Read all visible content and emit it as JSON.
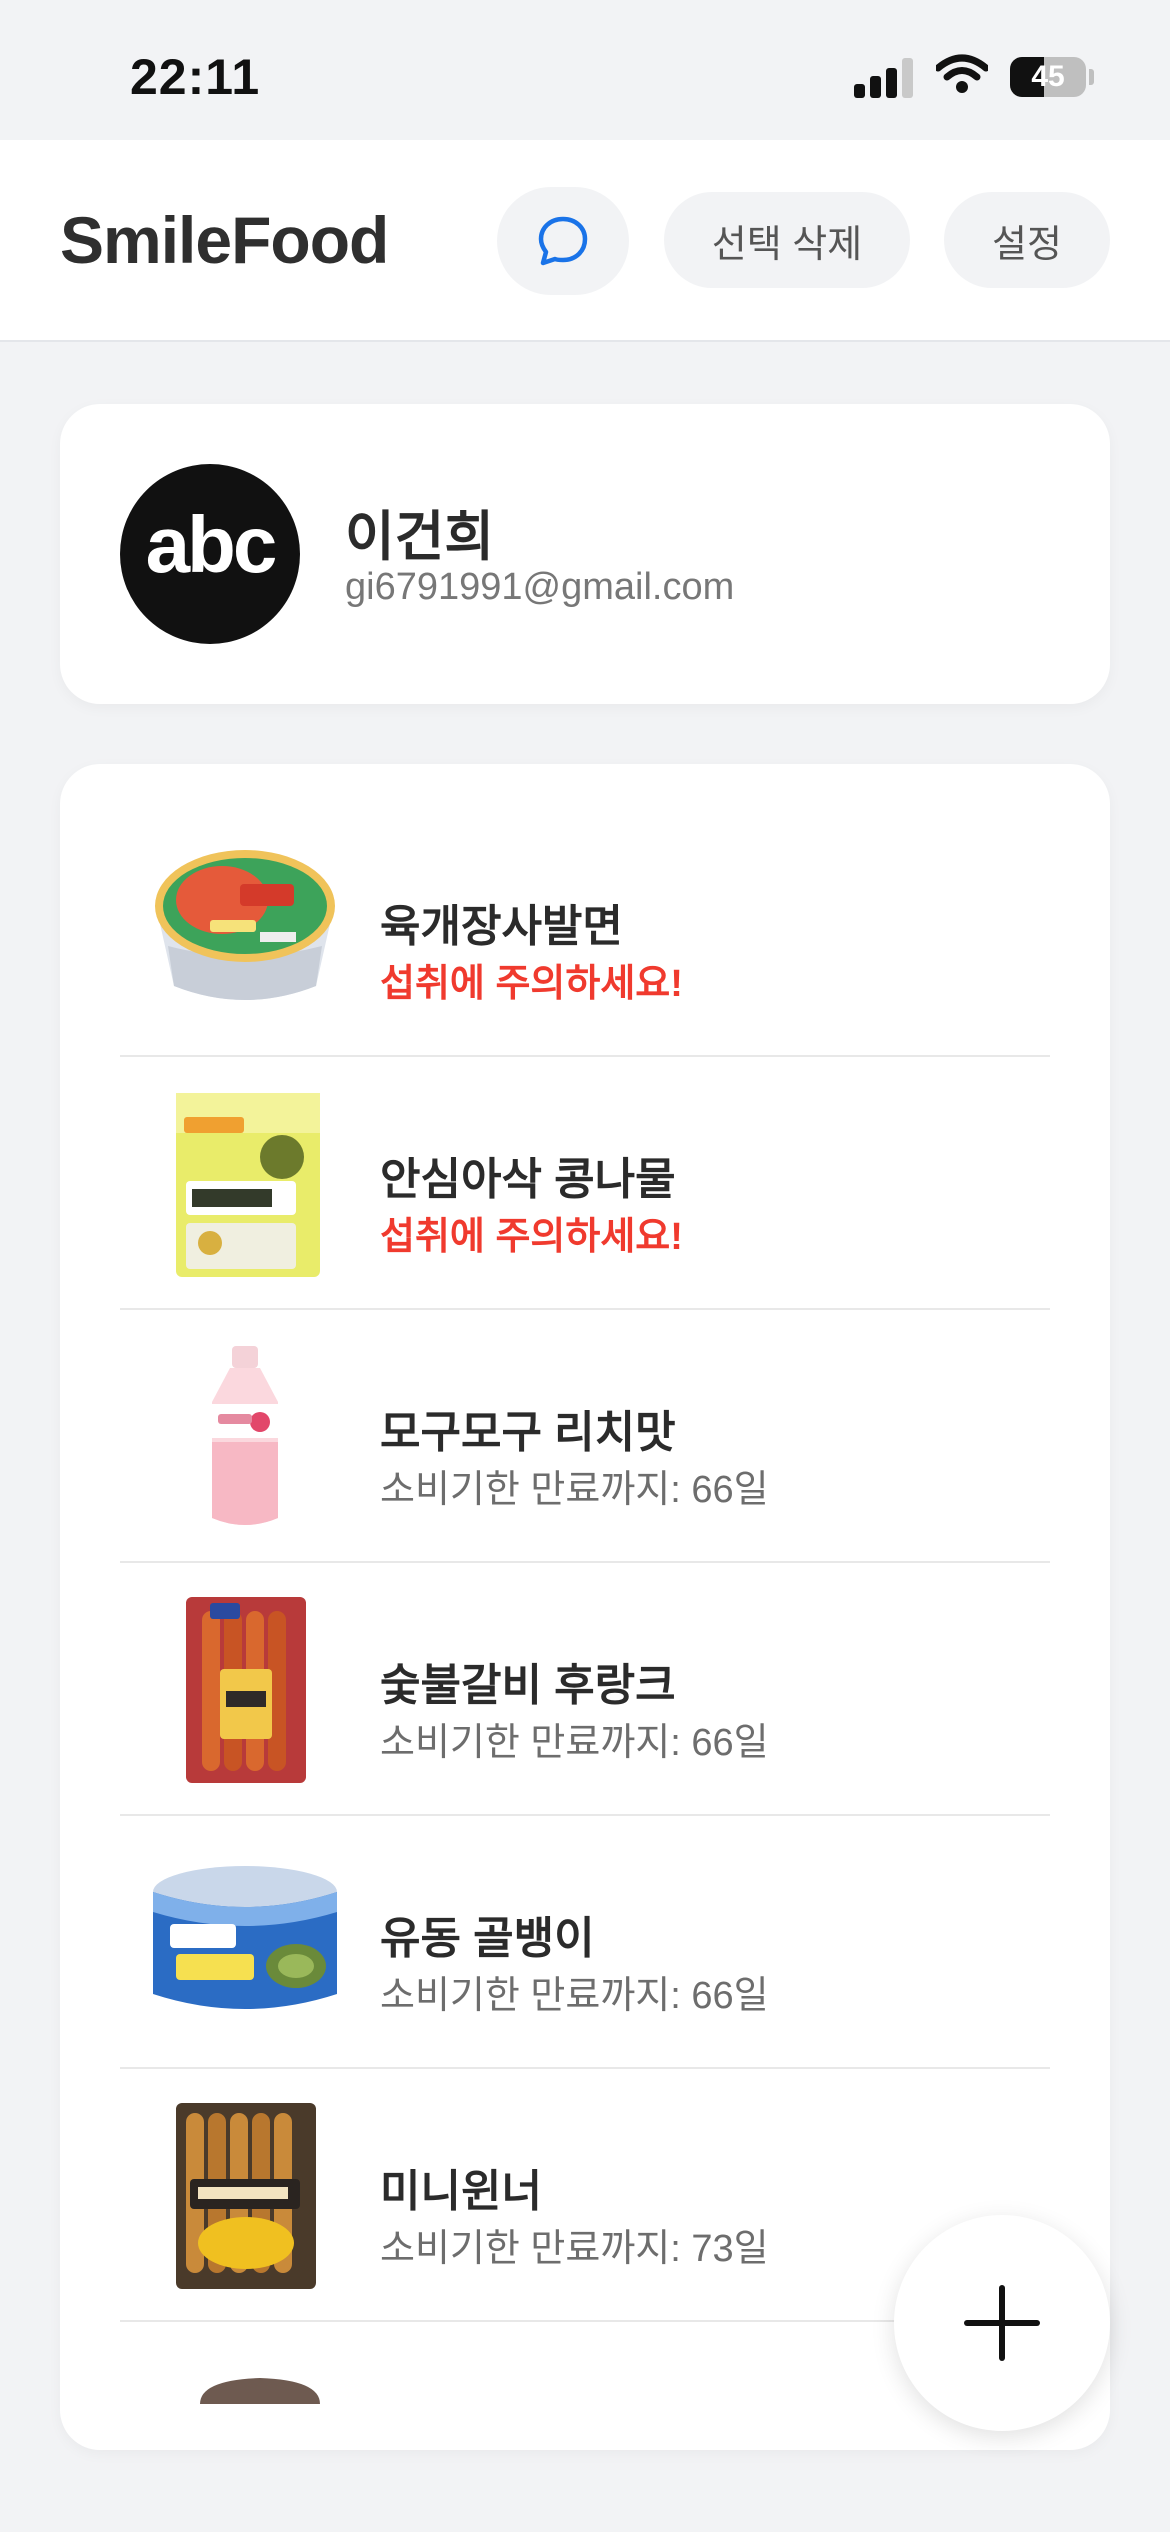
{
  "status_bar": {
    "time": "22:11",
    "battery": "45",
    "battery_level": 0.45
  },
  "header": {
    "title": "SmileFood",
    "chat_icon": "chat-bubble-icon",
    "delete_label": "선택 삭제",
    "settings_label": "설정"
  },
  "profile": {
    "avatar_text": "abc",
    "name": "이건희",
    "email": "gi6791991@gmail.com"
  },
  "items": [
    {
      "name": "육개장사발면",
      "status": "섭취에 주의하세요!",
      "warning": true,
      "icon": "ramen-cup-icon"
    },
    {
      "name": "안심아삭 콩나물",
      "status": "섭취에 주의하세요!",
      "warning": true,
      "icon": "bean-sprout-pack-icon"
    },
    {
      "name": "모구모구 리치맛",
      "status": "소비기한 만료까지: 66일",
      "warning": false,
      "icon": "drink-bottle-icon"
    },
    {
      "name": "숯불갈비 후랑크",
      "status": "소비기한 만료까지: 66일",
      "warning": false,
      "icon": "sausage-pack-icon"
    },
    {
      "name": "유동 골뱅이",
      "status": "소비기한 만료까지: 66일",
      "warning": false,
      "icon": "canned-whelk-icon"
    },
    {
      "name": "미니윈너",
      "status": "소비기한 만료까지: 73일",
      "warning": false,
      "icon": "mini-wiener-pack-icon"
    }
  ],
  "fab": {
    "icon": "plus-icon"
  },
  "colors": {
    "background": "#f2f3f5",
    "warning": "#f03a2e",
    "accent": "#1a73e8"
  }
}
